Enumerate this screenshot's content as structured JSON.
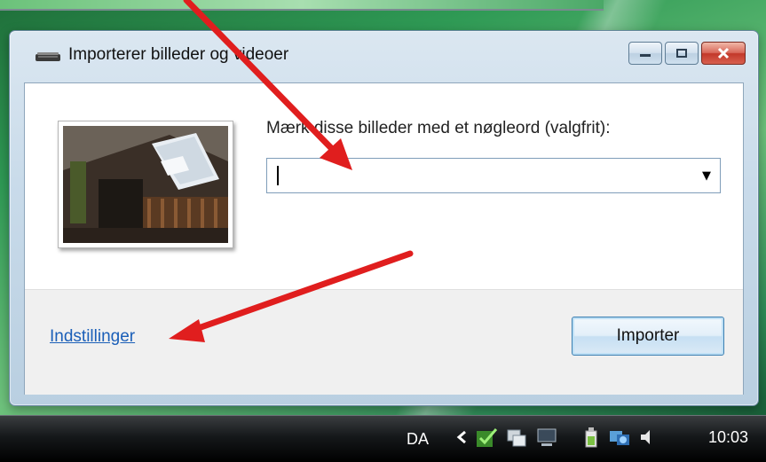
{
  "window": {
    "title": "Importerer billeder og videoer",
    "buttons": {
      "minimize": "minimize-icon",
      "maximize": "maximize-icon",
      "close": "close-icon"
    }
  },
  "content": {
    "prompt_label": "Mærk disse billeder med et nøgleord (valgfrit):",
    "keyword_input": {
      "value": "",
      "placeholder": ""
    }
  },
  "footer": {
    "settings_link": "Indstillinger",
    "import_button": "Importer"
  },
  "taskbar": {
    "language": "DA",
    "clock": "10:03",
    "tray_icons": [
      "chevron-left-icon",
      "security-check-icon",
      "network-icon",
      "display-icon",
      "power-icon",
      "network-status-icon",
      "volume-icon"
    ]
  },
  "colors": {
    "accent_link": "#1b5fb8",
    "annotation_arrow": "#e01e1e",
    "close_button": "#c2382a"
  }
}
